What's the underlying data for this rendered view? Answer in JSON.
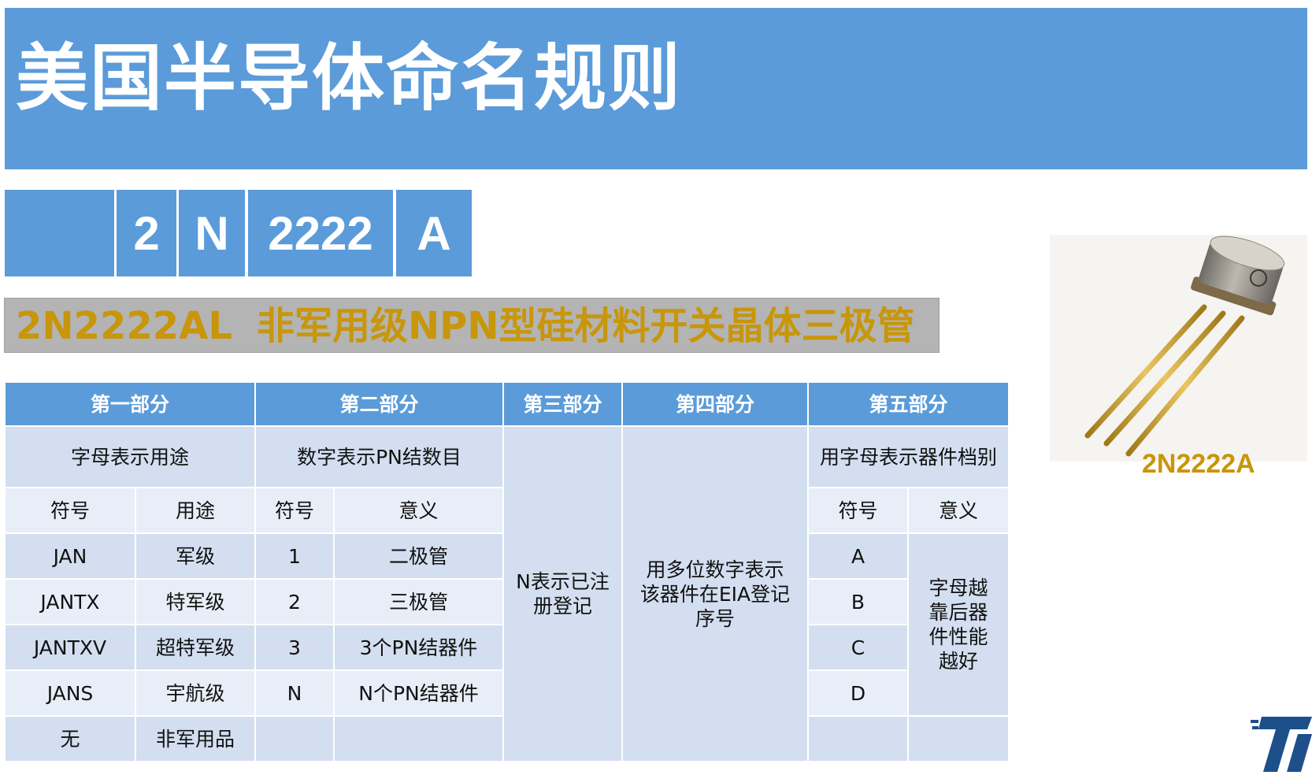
{
  "title": "美国半导体命名规则",
  "part_boxes": [
    "",
    "2",
    "N",
    "2222",
    "A"
  ],
  "description": {
    "code": "2N2222AL",
    "text": "非军用级NPN型硅材料开关晶体三极管"
  },
  "table": {
    "headers": [
      "第一部分",
      "第二部分",
      "第三部分",
      "第四部分",
      "第五部分"
    ],
    "row1": {
      "part1": "字母表示用途",
      "part2": "数字表示PN结数目",
      "part3": "N表示已注册登记",
      "part4": "用多位数字表示该器件在EIA登记序号",
      "part5": "用字母表示器件档别"
    },
    "subheaders": {
      "p1_symbol": "符号",
      "p1_meaning": "用途",
      "p2_symbol": "符号",
      "p2_meaning": "意义",
      "p5_symbol": "符号",
      "p5_meaning": "意义"
    },
    "rows": [
      {
        "p1_symbol": "JAN",
        "p1_meaning": "军级",
        "p2_symbol": "1",
        "p2_meaning": "二极管",
        "p5_symbol": "A"
      },
      {
        "p1_symbol": "JANTX",
        "p1_meaning": "特军级",
        "p2_symbol": "2",
        "p2_meaning": "三极管",
        "p5_symbol": "B"
      },
      {
        "p1_symbol": "JANTXV",
        "p1_meaning": "超特军级",
        "p2_symbol": "3",
        "p2_meaning": "3个PN结器件",
        "p5_symbol": "C"
      },
      {
        "p1_symbol": "JANS",
        "p1_meaning": "宇航级",
        "p2_symbol": "N",
        "p2_meaning": "N个PN结器件",
        "p5_symbol": "D"
      },
      {
        "p1_symbol": "无",
        "p1_meaning": "非军用品",
        "p2_symbol": "",
        "p2_meaning": "",
        "p5_symbol": ""
      }
    ],
    "p5_meaning_note": "字母越靠后器件性能越好"
  },
  "photo_label": "2N2222A",
  "colors": {
    "banner": "#5b9bd9",
    "table_cell": "#d3dff0",
    "accent_gold": "#c8960a",
    "desc_bg": "#b4b4b4"
  }
}
